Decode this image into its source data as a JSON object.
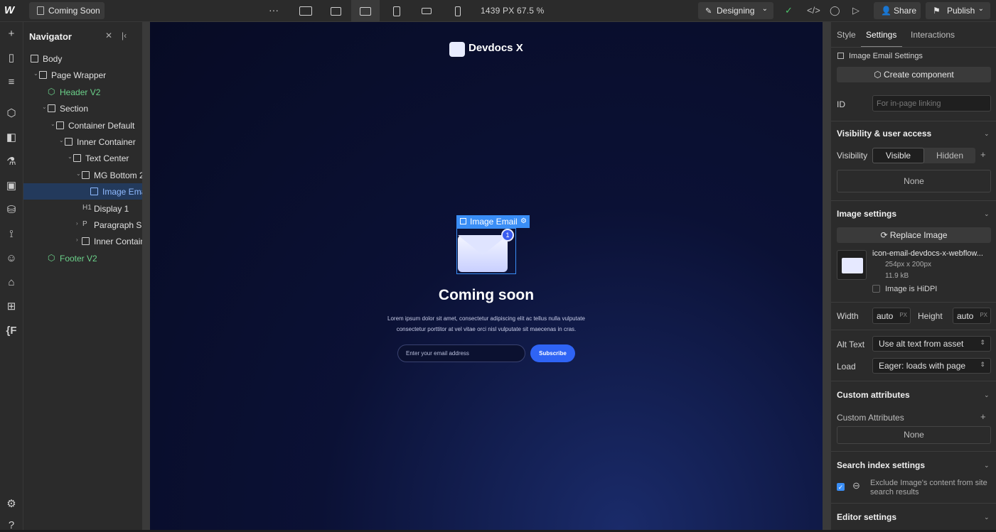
{
  "topbar": {
    "page_name": "Coming Soon",
    "more": "···",
    "viewport": "1439 PX  67.5 %",
    "mode": "Designing",
    "share": "Share",
    "publish": "Publish"
  },
  "navigator": {
    "title": "Navigator",
    "tree": [
      {
        "label": "Body",
        "indent": 0,
        "icon": "box"
      },
      {
        "label": "Page Wrapper",
        "indent": 1,
        "icon": "box",
        "caret": true
      },
      {
        "label": "Header V2",
        "indent": 2,
        "icon": "component",
        "component": true
      },
      {
        "label": "Section",
        "indent": 2,
        "icon": "section",
        "caret": true
      },
      {
        "label": "Container Default",
        "indent": 3,
        "icon": "container",
        "caret": true
      },
      {
        "label": "Inner Container",
        "indent": 4,
        "icon": "box",
        "caret": true
      },
      {
        "label": "Text Center",
        "indent": 5,
        "icon": "box",
        "caret": true
      },
      {
        "label": "MG Bottom 2",
        "indent": 6,
        "icon": "box",
        "caret": true
      },
      {
        "label": "Image Ema",
        "indent": 7,
        "icon": "image",
        "selected": true
      },
      {
        "label": "Display 1",
        "indent": 6,
        "icon": "H1"
      },
      {
        "label": "Paragraph S...",
        "indent": 6,
        "icon": "P",
        "caret": true
      },
      {
        "label": "Inner Contain",
        "indent": 6,
        "icon": "box",
        "caret": true
      },
      {
        "label": "Footer V2",
        "indent": 2,
        "icon": "component",
        "component": true
      }
    ]
  },
  "canvas": {
    "brand": "Devdocs X",
    "selection_label": "Image Email",
    "badge": "1",
    "heading": "Coming soon",
    "paragraph": "Lorem ipsum dolor sit amet, consectetur adipiscing elit ac tellus nulla vulputate consectetur porttitor at vel vitae orci nisl vulputate sit maecenas in cras.",
    "email_placeholder": "Enter your email address",
    "subscribe": "Subscribe"
  },
  "right_panel": {
    "tabs": [
      "Style",
      "Settings",
      "Interactions"
    ],
    "element_settings": "Image Email Settings",
    "create_component": "Create component",
    "id_label": "ID",
    "id_placeholder": "For in-page linking",
    "visibility_section": "Visibility & user access",
    "visibility_label": "Visibility",
    "visible": "Visible",
    "hidden": "Hidden",
    "visibility_none": "None",
    "image_section": "Image settings",
    "replace_image": "Replace Image",
    "file_name": "icon-email-devdocs-x-webflow...",
    "file_dims": "254px x 200px",
    "file_size": "11.9 kB",
    "hidpi": "Image is HiDPI",
    "width_label": "Width",
    "width_value": "auto",
    "height_label": "Height",
    "height_value": "auto",
    "unit": "PX",
    "alt_label": "Alt Text",
    "alt_value": "Use alt text from asset",
    "load_label": "Load",
    "load_value": "Eager: loads with page",
    "custom_section": "Custom attributes",
    "custom_label": "Custom Attributes",
    "custom_none": "None",
    "search_section": "Search index settings",
    "exclude_text": "Exclude Image's content from site search results",
    "editor_section": "Editor settings"
  },
  "colors": {
    "accent": "#3a8ef6",
    "component": "#6bd18a",
    "subscribe": "#2f64f5"
  }
}
